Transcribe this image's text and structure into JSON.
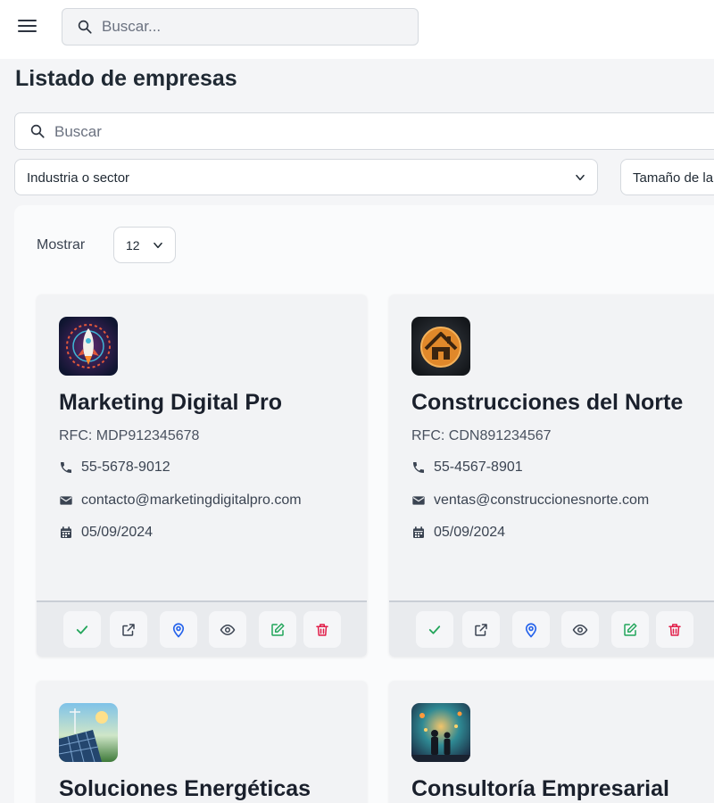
{
  "header": {
    "search_placeholder": "Buscar..."
  },
  "page": {
    "title": "Listado de empresas"
  },
  "filters": {
    "search_placeholder": "Buscar",
    "industry_label": "Industria o sector",
    "size_label": "Tamaño de la"
  },
  "pagination": {
    "show_label": "Mostrar",
    "page_size": "12"
  },
  "companies": [
    {
      "name": "Marketing Digital Pro",
      "rfc": "RFC: MDP912345678",
      "phone": "55-5678-9012",
      "email": "contacto@marketingdigitalpro.com",
      "date": "05/09/2024",
      "logo": "rocket-logo"
    },
    {
      "name": "Construcciones del Norte",
      "rfc": "RFC: CDN891234567",
      "phone": "55-4567-8901",
      "email": "ventas@construccionesnorte.com",
      "date": "05/09/2024",
      "logo": "house-logo"
    },
    {
      "name": "Soluciones Energéticas",
      "logo": "solar-panel-logo"
    },
    {
      "name": "Consultoría Empresarial",
      "logo": "consulting-logo"
    }
  ],
  "actions": [
    "check-icon",
    "external-link-icon",
    "map-pin-icon",
    "eye-icon",
    "edit-icon",
    "trash-icon"
  ],
  "colors": {
    "check": "#22a55a",
    "link": "#3b4452",
    "pin": "#2563eb",
    "eye": "#3b4452",
    "edit": "#22a55a",
    "trash": "#e11d48"
  }
}
